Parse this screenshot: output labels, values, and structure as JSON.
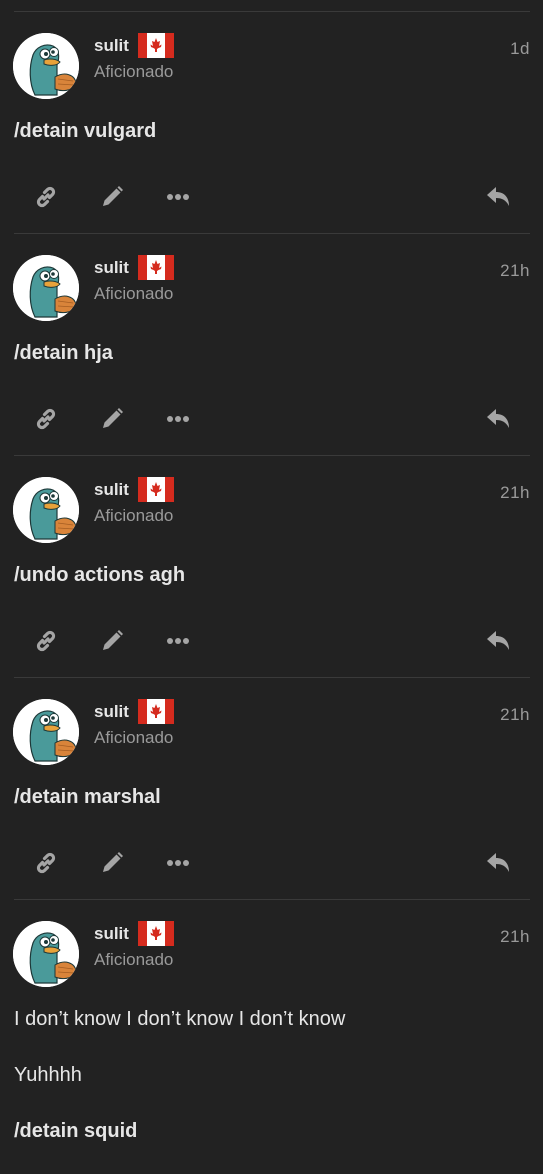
{
  "colors": {
    "background": "#222222",
    "divider": "#3a3a3a",
    "text": "#e6e6e6",
    "muted": "#9a9a9a",
    "icon": "#a5a5a5",
    "flag_red": "#d52b1e"
  },
  "posts": [
    {
      "username": "sulit",
      "user_title": "Aficionado",
      "time": "1d",
      "flag_icon": "canada-flag-icon",
      "paragraphs": [
        {
          "text": "/detain vulgard",
          "bold": true
        }
      ],
      "actions": [
        "link-icon",
        "pencil-icon",
        "more-icon",
        "reply-icon"
      ]
    },
    {
      "username": "sulit",
      "user_title": "Aficionado",
      "time": "21h",
      "flag_icon": "canada-flag-icon",
      "paragraphs": [
        {
          "text": "/detain hja",
          "bold": true
        }
      ],
      "actions": [
        "link-icon",
        "pencil-icon",
        "more-icon",
        "reply-icon"
      ]
    },
    {
      "username": "sulit",
      "user_title": "Aficionado",
      "time": "21h",
      "flag_icon": "canada-flag-icon",
      "paragraphs": [
        {
          "text": "/undo actions agh",
          "bold": true
        }
      ],
      "actions": [
        "link-icon",
        "pencil-icon",
        "more-icon",
        "reply-icon"
      ]
    },
    {
      "username": "sulit",
      "user_title": "Aficionado",
      "time": "21h",
      "flag_icon": "canada-flag-icon",
      "paragraphs": [
        {
          "text": "/detain marshal",
          "bold": true
        }
      ],
      "actions": [
        "link-icon",
        "pencil-icon",
        "more-icon",
        "reply-icon"
      ]
    },
    {
      "username": "sulit",
      "user_title": "Aficionado",
      "time": "21h",
      "flag_icon": "canada-flag-icon",
      "paragraphs": [
        {
          "text": "I don’t know I don’t know I don’t know",
          "bold": false
        },
        {
          "text": "Yuhhhh",
          "bold": false
        },
        {
          "text": "/detain squid",
          "bold": true
        }
      ],
      "actions": []
    }
  ]
}
